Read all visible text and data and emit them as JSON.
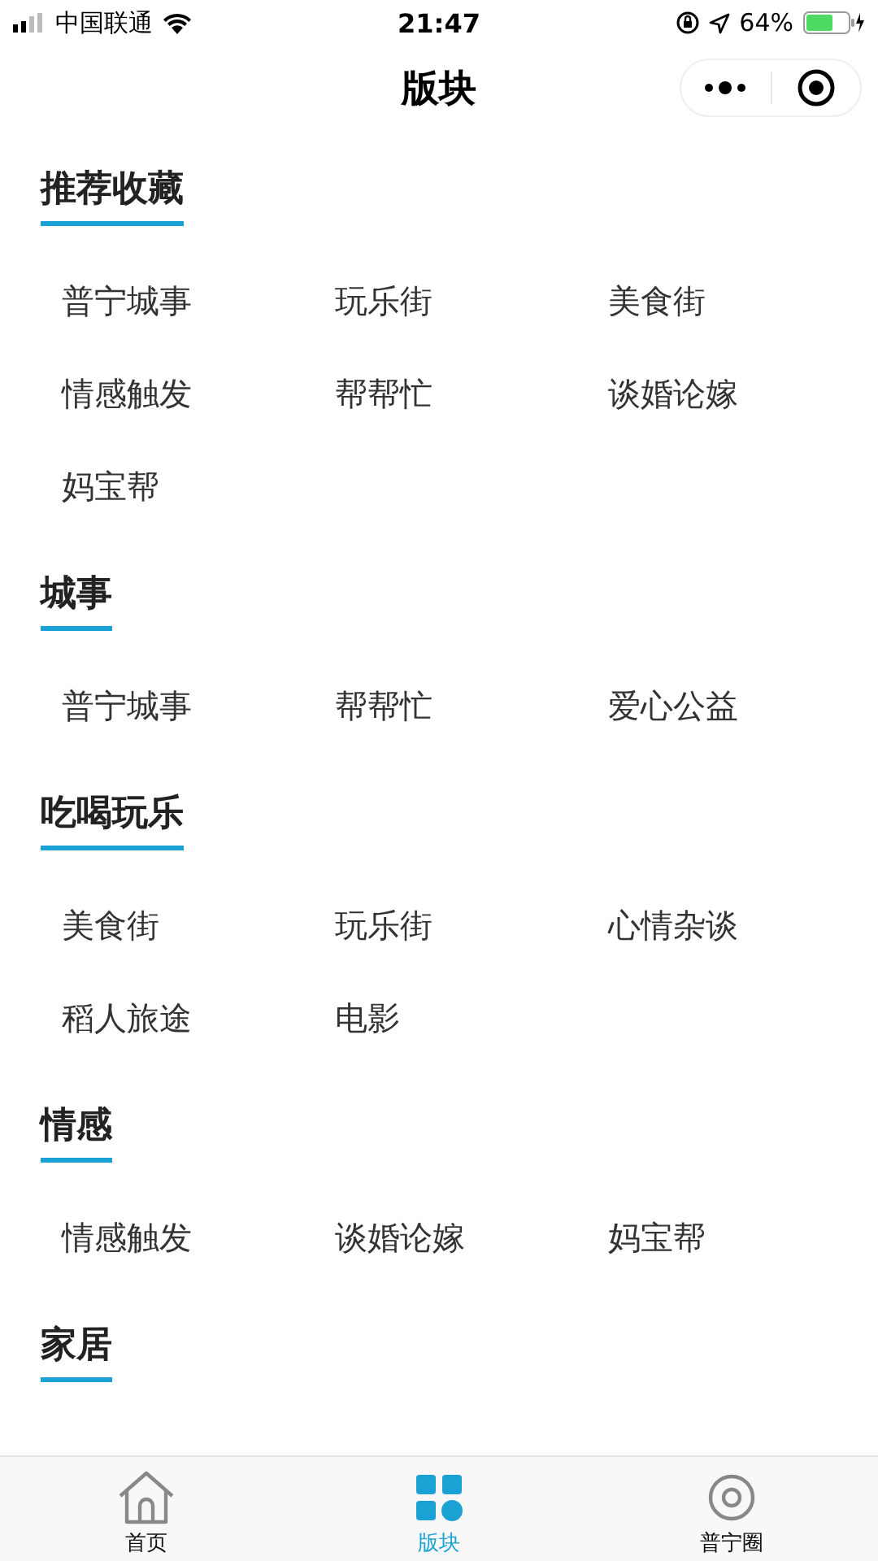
{
  "status_bar": {
    "carrier": "中国联通",
    "time": "21:47",
    "battery": "64%"
  },
  "nav": {
    "title": "版块"
  },
  "sections": [
    {
      "title": "推荐收藏",
      "items": [
        "普宁城事",
        "玩乐街",
        "美食街",
        "情感触发",
        "帮帮忙",
        "谈婚论嫁",
        "妈宝帮"
      ]
    },
    {
      "title": "城事",
      "items": [
        "普宁城事",
        "帮帮忙",
        "爱心公益"
      ]
    },
    {
      "title": "吃喝玩乐",
      "items": [
        "美食街",
        "玩乐街",
        "心情杂谈",
        "稻人旅途",
        "电影"
      ]
    },
    {
      "title": "情感",
      "items": [
        "情感触发",
        "谈婚论嫁",
        "妈宝帮"
      ]
    },
    {
      "title": "家居"
    }
  ],
  "tab_bar": [
    {
      "label": "首页",
      "kind": "home",
      "selected": false
    },
    {
      "label": "版块",
      "kind": "boards",
      "selected": true
    },
    {
      "label": "普宁圈",
      "kind": "circle",
      "selected": false
    }
  ]
}
